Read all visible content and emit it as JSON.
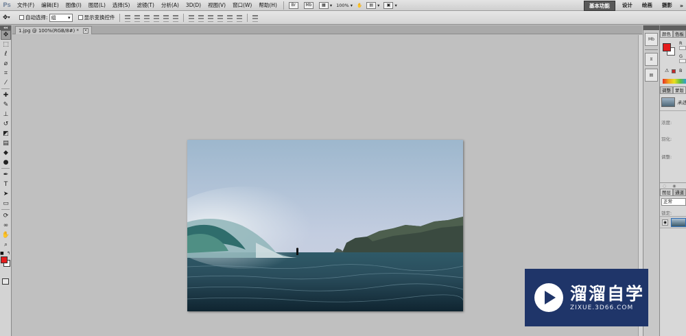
{
  "app": {
    "logo": "Ps"
  },
  "menu": [
    "文件(F)",
    "编辑(E)",
    "图像(I)",
    "图层(L)",
    "选择(S)",
    "滤镜(T)",
    "分析(A)",
    "3D(D)",
    "视图(V)",
    "窗口(W)",
    "帮助(H)"
  ],
  "appbar": {
    "br_label": "Br",
    "mb_label": "Mb",
    "zoom": "100%"
  },
  "workspaces": [
    "基本功能",
    "设计",
    "绘画",
    "摄影"
  ],
  "workspace_more": "»",
  "options": {
    "auto_select_label": "自动选择:",
    "auto_select_value": "组",
    "show_transform_label": "显示变换控件"
  },
  "document": {
    "tab_title": "1.jpg @ 100%(RGB/8#) *",
    "close": "×"
  },
  "panels": {
    "color_tabs": [
      "颜色",
      "色板"
    ],
    "color_labels": {
      "r": "R",
      "g": "G",
      "b": "B"
    },
    "adjust_tabs": [
      "调整",
      "蒙版"
    ],
    "adjust_layer_name": "未选",
    "adjust_labels": [
      "浓度:",
      "羽化:",
      "调整:"
    ],
    "layers_tabs": [
      "图层",
      "通道"
    ],
    "blend_mode": "正常",
    "lock_label": "锁定:"
  },
  "watermark": {
    "title": "溜溜自学",
    "url": "ZIXUE.3D66.COM"
  },
  "colors": {
    "foreground": "#e51c1c",
    "background": "#ffffff",
    "brand": "#1f3569"
  }
}
